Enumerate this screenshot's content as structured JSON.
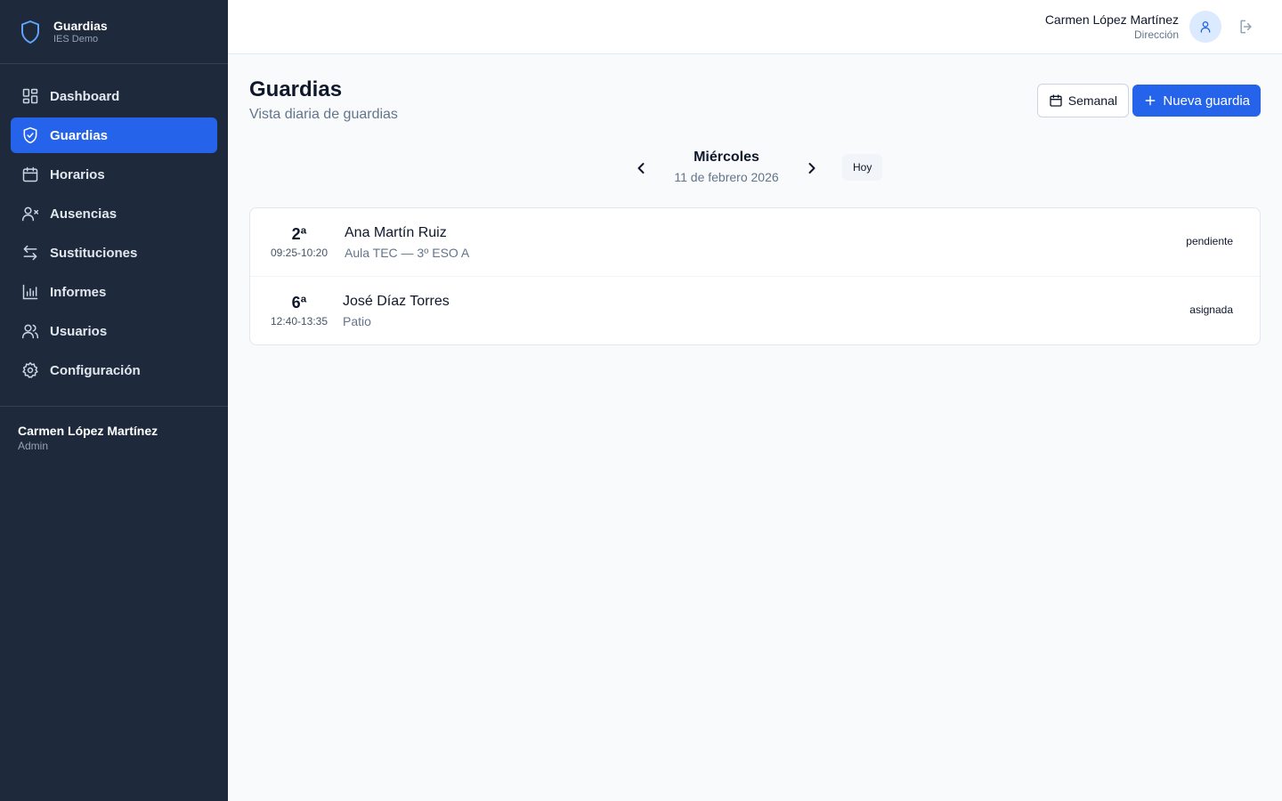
{
  "sidebar": {
    "brand": {
      "title": "Guardias",
      "subtitle": "IES Demo",
      "icon": "shield-icon"
    },
    "items": [
      {
        "label": "Dashboard",
        "icon": "dashboard-icon",
        "active": false
      },
      {
        "label": "Guardias",
        "icon": "shield-check-icon",
        "active": true
      },
      {
        "label": "Horarios",
        "icon": "calendar-icon",
        "active": false
      },
      {
        "label": "Ausencias",
        "icon": "user-x-icon",
        "active": false
      },
      {
        "label": "Sustituciones",
        "icon": "swap-arrows-icon",
        "active": false
      },
      {
        "label": "Informes",
        "icon": "bar-chart-icon",
        "active": false
      },
      {
        "label": "Usuarios",
        "icon": "users-icon",
        "active": false
      },
      {
        "label": "Configuración",
        "icon": "gear-icon",
        "active": false
      }
    ],
    "user": {
      "name": "Carmen López Martínez",
      "role": "Admin"
    }
  },
  "header": {
    "user_name": "Carmen López Martínez",
    "user_role": "Dirección",
    "avatar_icon": "user-icon",
    "logout_icon": "logout-icon"
  },
  "page": {
    "title": "Guardias",
    "subtitle": "Vista diaria de guardias",
    "week_button": "Semanal",
    "new_button": "Nueva guardia"
  },
  "date_nav": {
    "day": "Miércoles",
    "date": "11 de febrero 2026",
    "today_button": "Hoy"
  },
  "guardias": [
    {
      "period": "2ª",
      "time": "09:25-10:20",
      "teacher": "Ana Martín Ruiz",
      "location": "Aula TEC — 3º ESO A",
      "status": "pendiente"
    },
    {
      "period": "6ª",
      "time": "12:40-13:35",
      "teacher": "José Díaz Torres",
      "location": "Patio",
      "status": "asignada"
    }
  ],
  "colors": {
    "sidebar_bg": "#1e293b",
    "accent": "#2563eb",
    "page_bg": "#f8fafc"
  }
}
